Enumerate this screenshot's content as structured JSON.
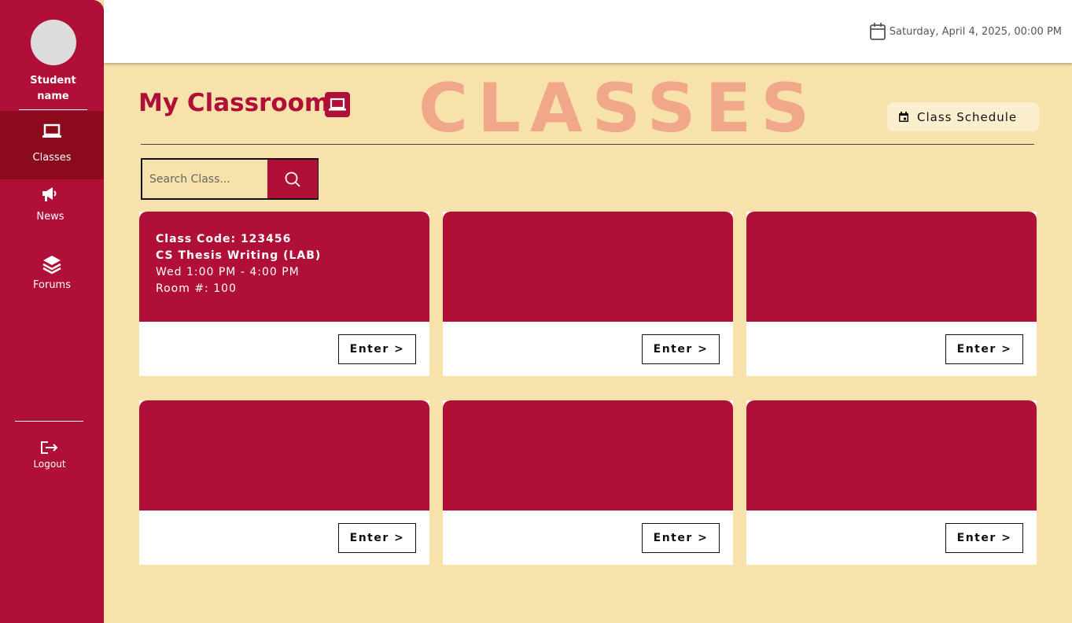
{
  "sidebar": {
    "student_name": "Student name",
    "items": [
      {
        "label": "Classes",
        "icon": "laptop-icon",
        "active": true
      },
      {
        "label": "News",
        "icon": "megaphone-icon"
      },
      {
        "label": "Forums",
        "icon": "layers-icon"
      }
    ],
    "logout_label": "Logout"
  },
  "topbar": {
    "datetime": "Saturday, April 4, 2025, 00:00 PM"
  },
  "header": {
    "title": "My Classroom",
    "watermark": "CLASSES",
    "schedule_button": "Class Schedule"
  },
  "search": {
    "placeholder": "Search Class..."
  },
  "cards": [
    {
      "code": "Class Code: 123456",
      "name": "CS Thesis Writing (LAB)",
      "schedule": "Wed 1:00 PM - 4:00 PM",
      "room": "Room #: 100",
      "enter_label": "Enter >"
    },
    {
      "enter_label": "Enter >"
    },
    {
      "enter_label": "Enter >"
    },
    {
      "enter_label": "Enter >"
    },
    {
      "enter_label": "Enter >"
    },
    {
      "enter_label": "Enter >"
    }
  ],
  "colors": {
    "primary": "#b01038",
    "primary_dark": "#8b0a1c",
    "background": "#f7e2ab",
    "watermark": "#f0a78a"
  }
}
